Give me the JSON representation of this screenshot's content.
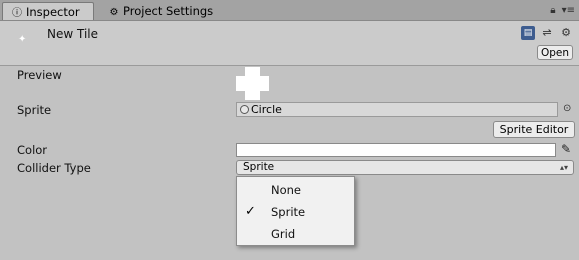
{
  "tabs": [
    {
      "label": "Inspector",
      "icon": "info-icon",
      "active": true
    },
    {
      "label": "Project Settings",
      "icon": "gear-icon",
      "active": false
    }
  ],
  "tabbar_icons": [
    "lock-icon",
    "window-menu-icon"
  ],
  "header": {
    "asset_name": "New Tile",
    "icons": [
      "help-book-icon",
      "presets-icon",
      "settings-gear-icon"
    ],
    "open_label": "Open"
  },
  "properties": {
    "preview_label": "Preview",
    "sprite_label": "Sprite",
    "sprite_value": "Circle",
    "sprite_editor_label": "Sprite Editor",
    "color_label": "Color",
    "color_value": "#ffffff",
    "collider_label": "Collider Type",
    "collider_value": "Sprite"
  },
  "collider_menu": {
    "options": [
      {
        "label": "None",
        "checked": false
      },
      {
        "label": "Sprite",
        "checked": true
      },
      {
        "label": "Grid",
        "checked": false
      }
    ],
    "check_glyph": "✓"
  },
  "colors": {
    "panel": "#c2c2c2",
    "tabbar": "#a3a3a3",
    "menu_bg": "#f1f1f1",
    "help_icon_blue": "#3d5c8f"
  }
}
